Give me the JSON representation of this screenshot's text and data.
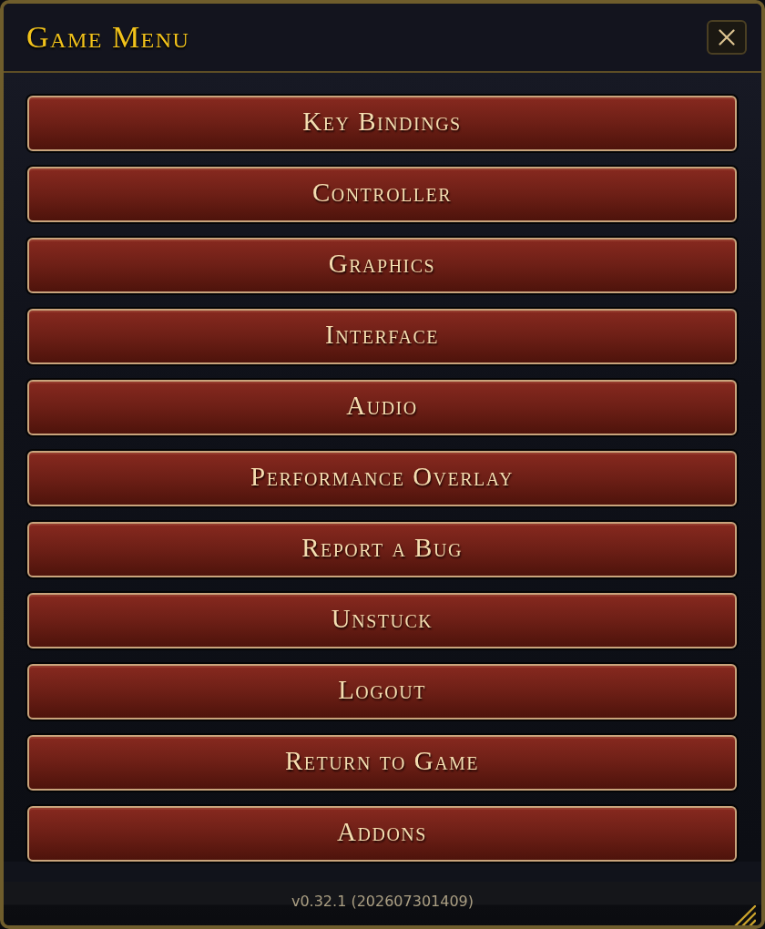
{
  "window": {
    "title": "Game Menu"
  },
  "buttons": [
    {
      "label": "Key Bindings"
    },
    {
      "label": "Controller"
    },
    {
      "label": "Graphics"
    },
    {
      "label": "Interface"
    },
    {
      "label": "Audio"
    },
    {
      "label": "Performance Overlay"
    },
    {
      "label": "Report a Bug"
    },
    {
      "label": "Unstuck"
    },
    {
      "label": "Logout"
    },
    {
      "label": "Return to Game"
    },
    {
      "label": "Addons"
    }
  ],
  "footer": {
    "version": "v0.32.1 (202607301409)"
  }
}
